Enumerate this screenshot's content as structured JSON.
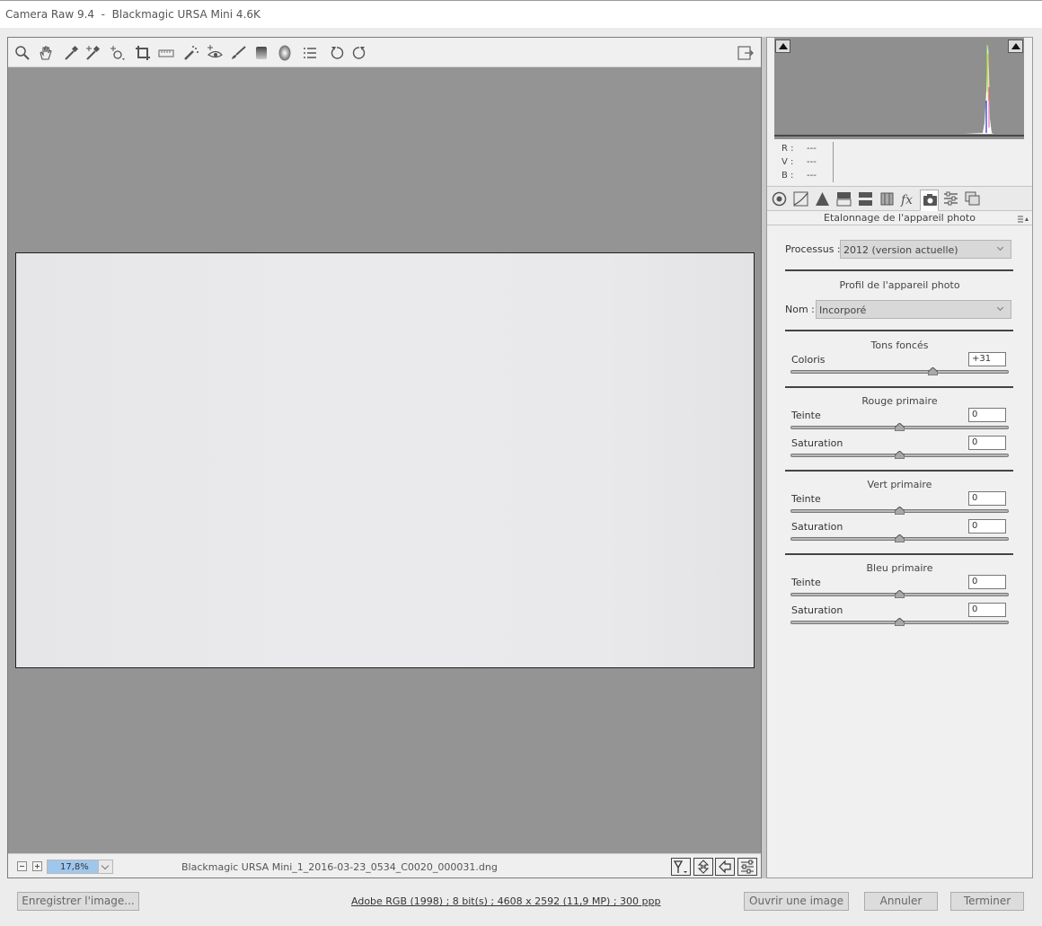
{
  "window": {
    "title": "Camera Raw 9.4  -  Blackmagic URSA Mini 4.6K"
  },
  "toolbar": {
    "tools": [
      {
        "name": "zoom-icon"
      },
      {
        "name": "hand-icon"
      },
      {
        "name": "white-balance-eyedropper-icon"
      },
      {
        "name": "color-sampler-icon"
      },
      {
        "name": "targeted-adjustment-icon"
      },
      {
        "name": "crop-icon"
      },
      {
        "name": "straighten-icon"
      },
      {
        "name": "spot-removal-icon"
      },
      {
        "name": "red-eye-icon"
      },
      {
        "name": "adjustment-brush-icon"
      },
      {
        "name": "graduated-filter-icon"
      },
      {
        "name": "radial-filter-icon"
      },
      {
        "name": "preferences-list-icon"
      },
      {
        "name": "rotate-left-icon"
      },
      {
        "name": "rotate-right-icon"
      }
    ],
    "fullscreen_icon": "fullscreen-toggle-icon"
  },
  "status": {
    "zoom": "17,8%",
    "filename": "Blackmagic URSA Mini_1_2016-03-23_0534_C0020_000031.dng"
  },
  "histogram": {
    "r_label": "R :",
    "r_value": "---",
    "g_label": "V :",
    "g_value": "---",
    "b_label": "B :",
    "b_value": "---"
  },
  "panel": {
    "title": "Etalonnage de l'appareil photo",
    "process_label": "Processus :",
    "process_value": "2012 (version actuelle)",
    "profile_title": "Profil de l'appareil photo",
    "name_label": "Nom :",
    "name_value": "Incorporé",
    "sections": [
      {
        "title": "Tons foncés",
        "sliders": [
          {
            "label": "Coloris",
            "value": "+31",
            "level": 31
          }
        ]
      },
      {
        "title": "Rouge primaire",
        "sliders": [
          {
            "label": "Teinte",
            "value": "0",
            "level": 0
          },
          {
            "label": "Saturation",
            "value": "0",
            "level": 0
          }
        ]
      },
      {
        "title": "Vert primaire",
        "sliders": [
          {
            "label": "Teinte",
            "value": "0",
            "level": 0
          },
          {
            "label": "Saturation",
            "value": "0",
            "level": 0
          }
        ]
      },
      {
        "title": "Bleu primaire",
        "sliders": [
          {
            "label": "Teinte",
            "value": "0",
            "level": 0
          },
          {
            "label": "Saturation",
            "value": "0",
            "level": 0
          }
        ]
      }
    ]
  },
  "bottom": {
    "save_label": "Enregistrer l'image...",
    "info": "Adobe RGB (1998) ; 8 bit(s) ; 4608 x 2592 (11,9 MP) ; 300 ppp",
    "open_label": "Ouvrir une image",
    "cancel_label": "Annuler",
    "done_label": "Terminer"
  }
}
